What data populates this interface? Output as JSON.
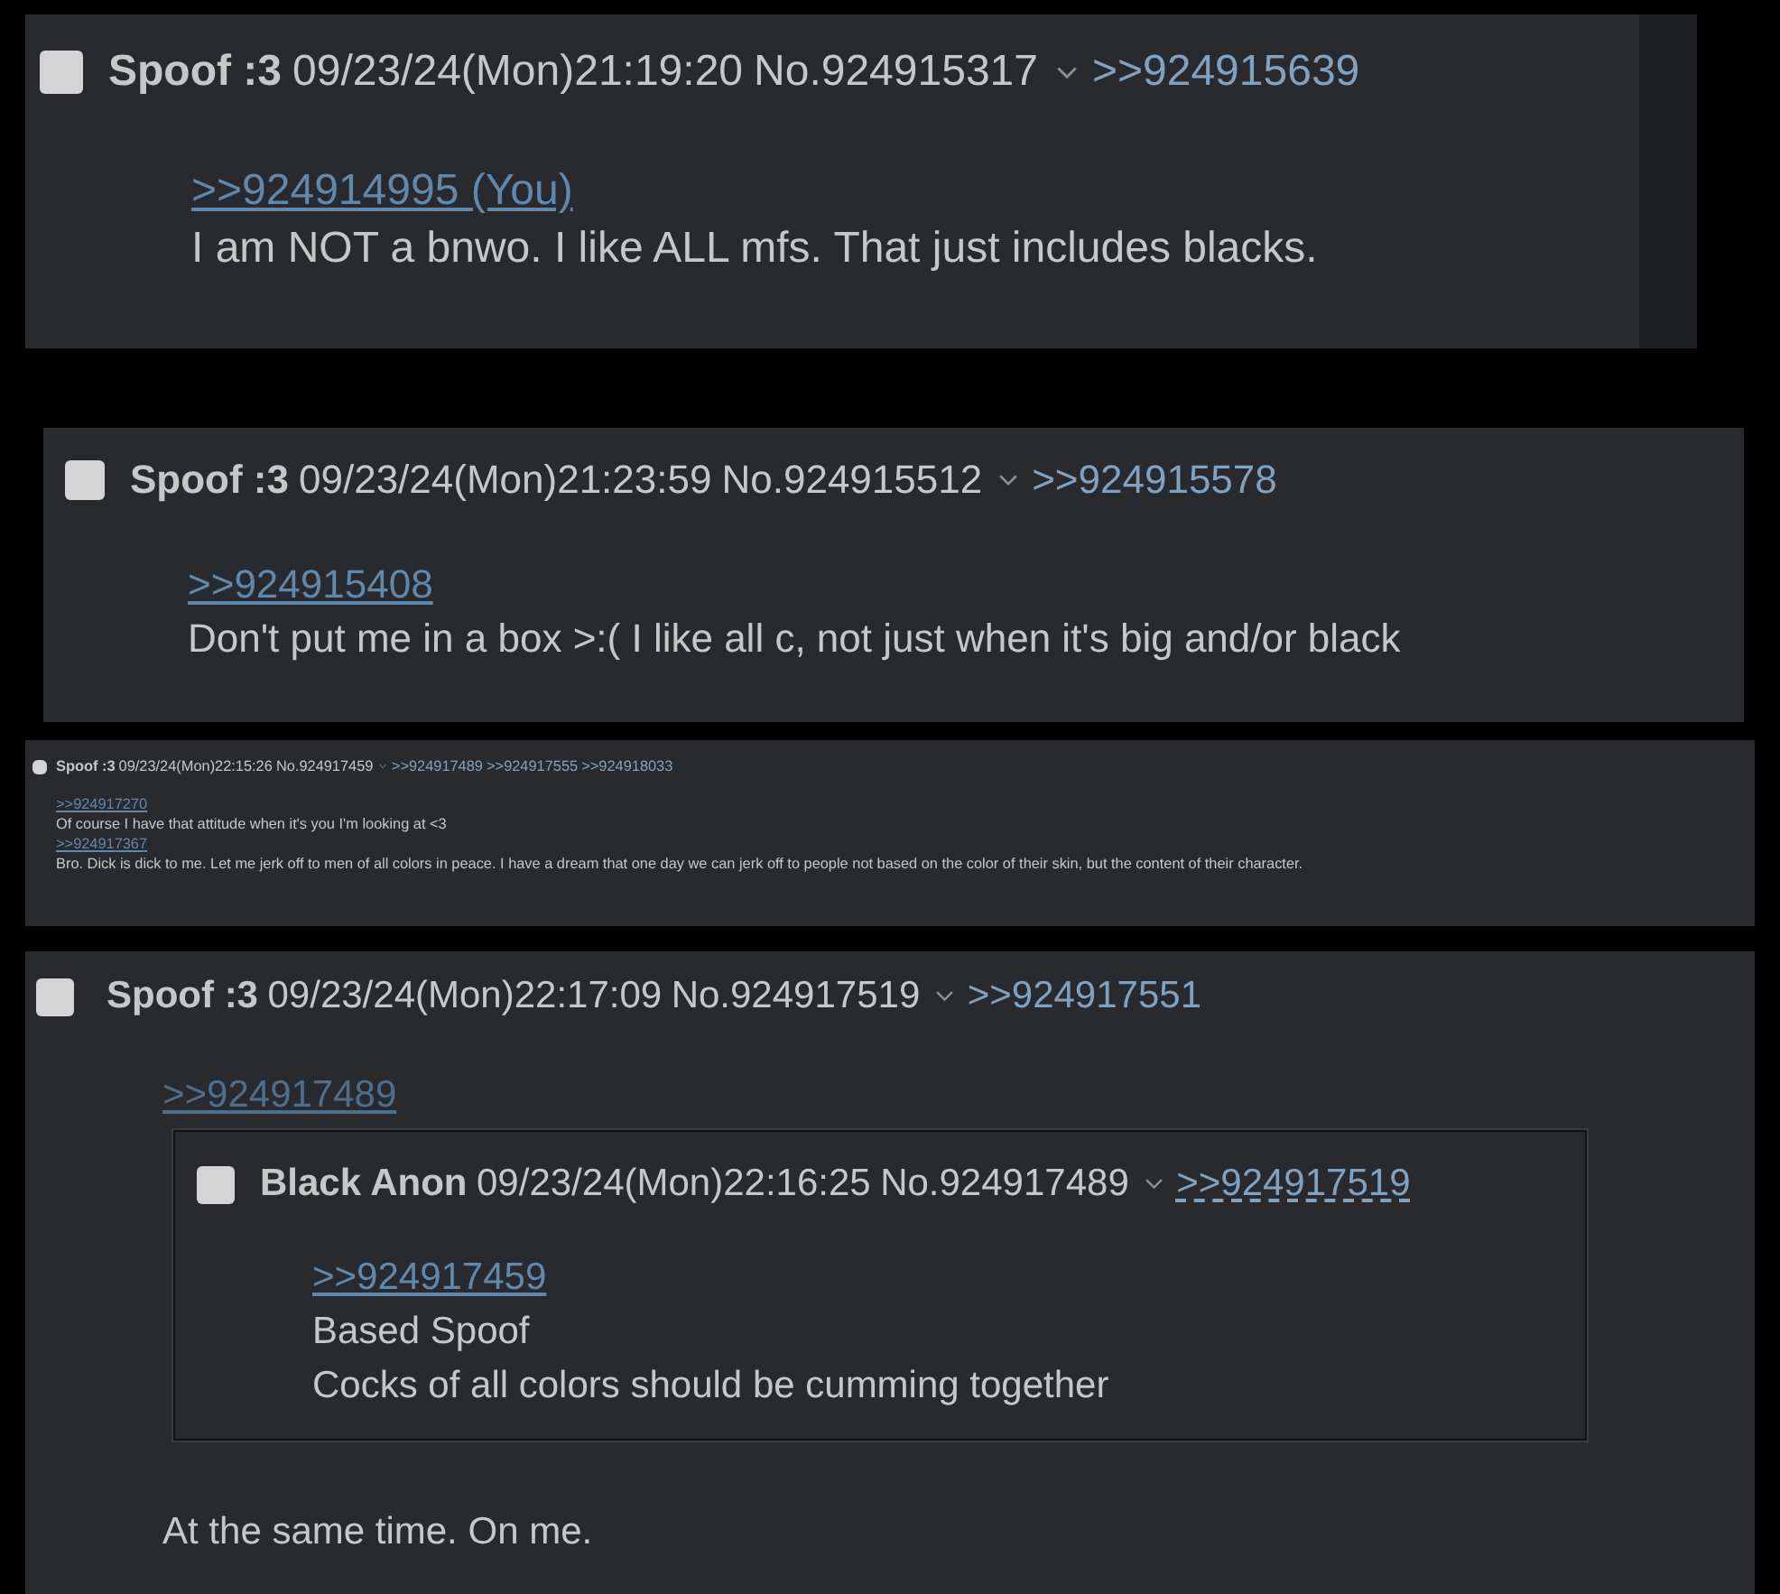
{
  "posts": [
    {
      "checked": false,
      "name": "Spoof :3",
      "datetime": "09/23/24(Mon)21:19:20",
      "number": "No.924915317",
      "replies": [
        ">>924915639"
      ],
      "body": [
        {
          "kind": "quote",
          "text": ">>924914995 (You)"
        },
        {
          "kind": "text",
          "text": "I am NOT a bnwo. I like ALL mfs. That just includes blacks."
        }
      ]
    },
    {
      "checked": false,
      "name": "Spoof :3",
      "datetime": "09/23/24(Mon)21:23:59",
      "number": "No.924915512",
      "replies": [
        ">>924915578"
      ],
      "body": [
        {
          "kind": "quote",
          "text": ">>924915408"
        },
        {
          "kind": "text",
          "text": "Don't put me in a box >:( I like all c, not just when it's big and/or black"
        }
      ]
    },
    {
      "checked": false,
      "name": "Spoof :3",
      "datetime": "09/23/24(Mon)22:15:26",
      "number": "No.924917459",
      "replies": [
        ">>924917489",
        ">>924917555",
        ">>924918033"
      ],
      "body": [
        {
          "kind": "quote",
          "text": ">>924917270"
        },
        {
          "kind": "text",
          "text": "Of course I have that attitude when it's you I'm looking at <3"
        },
        {
          "kind": "quote",
          "text": ">>924917367"
        },
        {
          "kind": "text",
          "text": "Bro. Dick is dick to me. Let me jerk off to men of all colors in peace. I have a dream that one day we can jerk off to people not based on the color of their skin, but the content of their character."
        }
      ]
    },
    {
      "checked": false,
      "name": "Spoof :3",
      "datetime": "09/23/24(Mon)22:17:09",
      "number": "No.924917519",
      "replies": [
        ">>924917551"
      ],
      "body": [
        {
          "kind": "quote",
          "text": ">>924917489"
        },
        {
          "kind": "inline_post",
          "post": {
            "checked": false,
            "name": "Black Anon",
            "datetime": "09/23/24(Mon)22:16:25",
            "number": "No.924917489",
            "replies": [
              ">>924917519"
            ],
            "body": [
              {
                "kind": "quote",
                "text": ">>924917459"
              },
              {
                "kind": "text",
                "text": "Based Spoof"
              },
              {
                "kind": "text",
                "text": "Cocks of all colors should be cumming together"
              }
            ]
          }
        },
        {
          "kind": "text",
          "text": "At the same time. On me."
        }
      ]
    }
  ]
}
